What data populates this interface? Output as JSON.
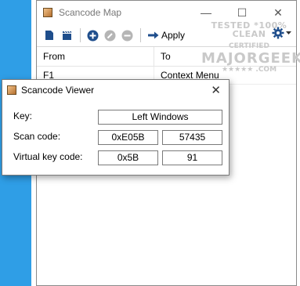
{
  "main_window": {
    "title": "Scancode Map",
    "controls": {
      "minimize": "—",
      "maximize": "☐",
      "close": "✕"
    },
    "toolbar": {
      "apply_label": "Apply"
    },
    "grid": {
      "headers": {
        "from": "From",
        "to": "To"
      },
      "rows": [
        {
          "from": "F1",
          "to": "Context Menu"
        }
      ]
    },
    "watermark": {
      "top": "TESTED *100% CLEAN",
      "mid": "CERTIFIED",
      "brand": "MAJORGEEKS",
      "com": "★★★★★ .COM"
    }
  },
  "dialog": {
    "title": "Scancode Viewer",
    "close": "✕",
    "key_label": "Key:",
    "key_value": "Left Windows",
    "scan_label": "Scan code:",
    "scan_hex": "0xE05B",
    "scan_dec": "57435",
    "vk_label": "Virtual key code:",
    "vk_hex": "0x5B",
    "vk_dec": "91"
  },
  "colors": {
    "desktop": "#2f9ee6",
    "toolbar_icon": "#1f4e8c"
  }
}
